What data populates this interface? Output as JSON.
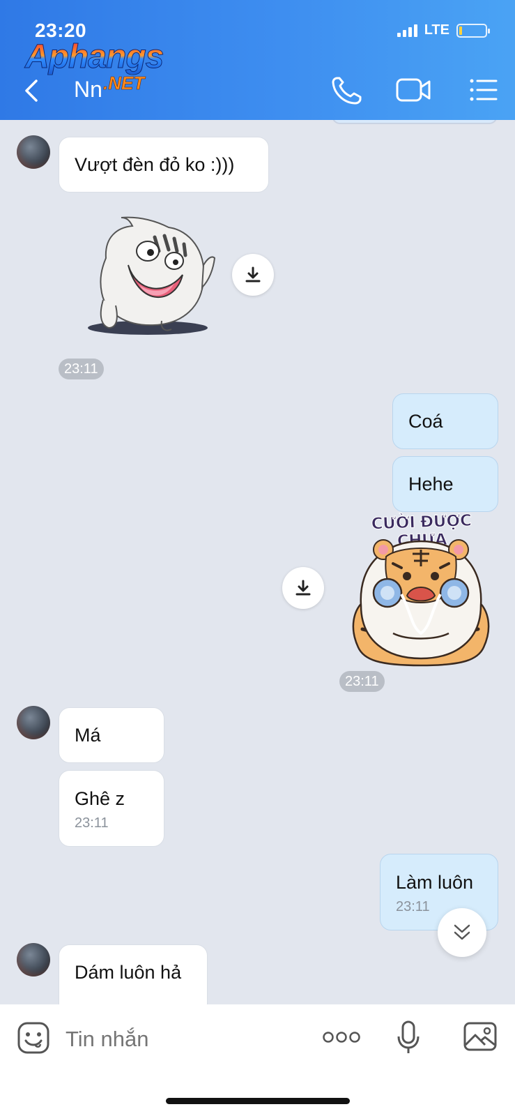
{
  "status_bar": {
    "time": "23:20",
    "network": "LTE"
  },
  "watermark": {
    "main": "Aphangs",
    "suffix": ".NET"
  },
  "header": {
    "contact_name": "Nn"
  },
  "messages": {
    "m1": {
      "text": "Vượt đèn đỏ ko :)))"
    },
    "sticker1_time": "23:11",
    "m2": {
      "text": "Coá"
    },
    "m3": {
      "text": "Hehe"
    },
    "sticker2": {
      "caption": "CƯỜI ĐƯỢC CHƯA",
      "time": "23:11"
    },
    "m4": {
      "text": "Má"
    },
    "m5": {
      "text": "Ghê z",
      "time": "23:11"
    },
    "m6": {
      "text": "Làm luôn",
      "time": "23:11"
    },
    "m7": {
      "text": "Dám luôn hả"
    }
  },
  "composer": {
    "placeholder": "Tin nhắn"
  },
  "icons": {
    "back": "chevron-left-icon",
    "call": "phone-icon",
    "video": "video-camera-icon",
    "menu": "list-menu-icon",
    "download": "download-icon",
    "scroll_down": "double-chevron-down-icon",
    "emoji": "emoji-icon",
    "more": "more-dots-icon",
    "mic": "microphone-icon",
    "image": "image-icon"
  },
  "colors": {
    "header_start": "#2f79e6",
    "header_end": "#4aa3f4",
    "chat_bg": "#e2e6ee",
    "bubble_out": "#d6ecfc",
    "bubble_in": "#ffffff"
  }
}
